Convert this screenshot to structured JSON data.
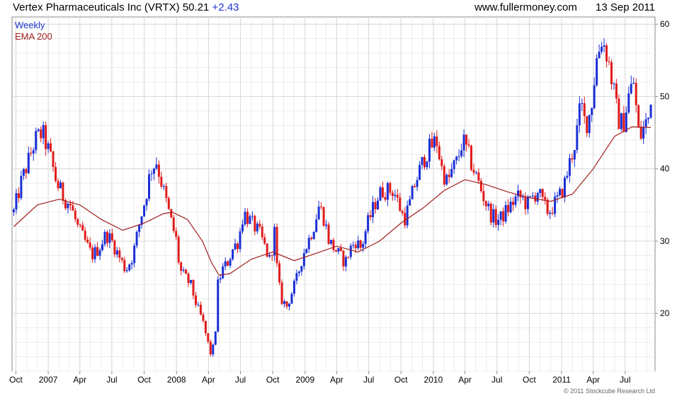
{
  "header": {
    "title": "Vertex Pharmaceuticals Inc (VRTX)",
    "price": "50.21",
    "change": "+2.43",
    "source": "www.fullermoney.com",
    "date": "13 Sep 2011"
  },
  "footer": {
    "copyright": "© 2011 Stockcube Research Ltd"
  },
  "colors": {
    "up": "#1a2fd6",
    "down": "#e01b1b",
    "ema": "#a11d1d",
    "grid": "#d9d9d9",
    "border": "#888888",
    "legend_weekly": "#1a33cc",
    "legend_ema": "#a11d1d"
  },
  "chart_data": {
    "type": "line",
    "title": "",
    "xlabel": "",
    "ylabel": "",
    "ylim": [
      12,
      61
    ],
    "yticks": [
      20,
      30,
      40,
      50,
      60
    ],
    "y_axis_position": "right",
    "grid": true,
    "legend_placement": "top-left",
    "x_ticks": [
      "Oct",
      "2007",
      "Apr",
      "Jul",
      "Oct",
      "2008",
      "Apr",
      "Jul",
      "Oct",
      "2009",
      "Apr",
      "Jul",
      "Oct",
      "2010",
      "Apr",
      "Jul",
      "Oct",
      "2011",
      "Apr",
      "Jul"
    ],
    "x_tick_dates": [
      "2006-10-01",
      "2007-01-01",
      "2007-04-01",
      "2007-07-01",
      "2007-10-01",
      "2008-01-01",
      "2008-04-01",
      "2008-07-01",
      "2008-10-01",
      "2009-01-01",
      "2009-04-01",
      "2009-07-01",
      "2009-10-01",
      "2010-01-01",
      "2010-04-01",
      "2010-07-01",
      "2010-10-01",
      "2011-01-01",
      "2011-04-01",
      "2011-07-01"
    ],
    "x_range": [
      "2006-09-20",
      "2011-09-24"
    ],
    "series": [
      {
        "name": "Weekly",
        "style": "candlestick",
        "close_points": [
          [
            "2006-09-25",
            34
          ],
          [
            "2006-10-15",
            38
          ],
          [
            "2006-11-05",
            41
          ],
          [
            "2006-11-25",
            44
          ],
          [
            "2006-12-15",
            45
          ],
          [
            "2007-01-05",
            42
          ],
          [
            "2007-01-25",
            38
          ],
          [
            "2007-02-15",
            36
          ],
          [
            "2007-03-05",
            35
          ],
          [
            "2007-03-25",
            32
          ],
          [
            "2007-04-15",
            30
          ],
          [
            "2007-05-05",
            28
          ],
          [
            "2007-05-25",
            29
          ],
          [
            "2007-06-15",
            31
          ],
          [
            "2007-07-01",
            30
          ],
          [
            "2007-07-20",
            28
          ],
          [
            "2007-08-10",
            26
          ],
          [
            "2007-08-30",
            28
          ],
          [
            "2007-09-20",
            33
          ],
          [
            "2007-10-05",
            36
          ],
          [
            "2007-10-20",
            40
          ],
          [
            "2007-11-05",
            41
          ],
          [
            "2007-11-25",
            37
          ],
          [
            "2007-12-15",
            33
          ],
          [
            "2008-01-01",
            30
          ],
          [
            "2008-01-10",
            26
          ],
          [
            "2008-01-25",
            25
          ],
          [
            "2008-02-10",
            24
          ],
          [
            "2008-02-28",
            21
          ],
          [
            "2008-03-15",
            19
          ],
          [
            "2008-03-30",
            16
          ],
          [
            "2008-04-10",
            14
          ],
          [
            "2008-04-20",
            17
          ],
          [
            "2008-04-28",
            24
          ],
          [
            "2008-05-10",
            26
          ],
          [
            "2008-05-25",
            27
          ],
          [
            "2008-06-10",
            29
          ],
          [
            "2008-06-25",
            30
          ],
          [
            "2008-07-10",
            34
          ],
          [
            "2008-07-25",
            33
          ],
          [
            "2008-08-10",
            32
          ],
          [
            "2008-08-25",
            31
          ],
          [
            "2008-09-10",
            29
          ],
          [
            "2008-09-25",
            27
          ],
          [
            "2008-10-05",
            32
          ],
          [
            "2008-10-15",
            25
          ],
          [
            "2008-10-25",
            22
          ],
          [
            "2008-11-10",
            21
          ],
          [
            "2008-11-25",
            23
          ],
          [
            "2008-12-10",
            25
          ],
          [
            "2008-12-25",
            28
          ],
          [
            "2009-01-10",
            30
          ],
          [
            "2009-01-25",
            32
          ],
          [
            "2009-02-10",
            35
          ],
          [
            "2009-02-25",
            33
          ],
          [
            "2009-03-10",
            30
          ],
          [
            "2009-03-25",
            29
          ],
          [
            "2009-04-10",
            28
          ],
          [
            "2009-04-25",
            27
          ],
          [
            "2009-05-10",
            29
          ],
          [
            "2009-05-25",
            30
          ],
          [
            "2009-06-10",
            29
          ],
          [
            "2009-06-25",
            32
          ],
          [
            "2009-07-10",
            34
          ],
          [
            "2009-07-25",
            36
          ],
          [
            "2009-08-10",
            37
          ],
          [
            "2009-08-25",
            37
          ],
          [
            "2009-09-10",
            37
          ],
          [
            "2009-09-25",
            35
          ],
          [
            "2009-10-10",
            33
          ],
          [
            "2009-10-25",
            35
          ],
          [
            "2009-11-10",
            38
          ],
          [
            "2009-11-25",
            40
          ],
          [
            "2009-12-10",
            42
          ],
          [
            "2009-12-25",
            43
          ],
          [
            "2010-01-10",
            44
          ],
          [
            "2010-01-25",
            40
          ],
          [
            "2010-02-10",
            38
          ],
          [
            "2010-02-25",
            40
          ],
          [
            "2010-03-10",
            41
          ],
          [
            "2010-03-25",
            44
          ],
          [
            "2010-04-10",
            42
          ],
          [
            "2010-04-25",
            40
          ],
          [
            "2010-05-10",
            38
          ],
          [
            "2010-05-25",
            36
          ],
          [
            "2010-06-10",
            34
          ],
          [
            "2010-06-25",
            33
          ],
          [
            "2010-07-10",
            33
          ],
          [
            "2010-07-25",
            34
          ],
          [
            "2010-08-10",
            35
          ],
          [
            "2010-08-25",
            36
          ],
          [
            "2010-09-10",
            36
          ],
          [
            "2010-09-25",
            35
          ],
          [
            "2010-10-10",
            36
          ],
          [
            "2010-10-25",
            37
          ],
          [
            "2010-11-10",
            35
          ],
          [
            "2010-11-25",
            34
          ],
          [
            "2010-12-10",
            35
          ],
          [
            "2010-12-25",
            36
          ],
          [
            "2011-01-10",
            38
          ],
          [
            "2011-01-25",
            41
          ],
          [
            "2011-02-10",
            44
          ],
          [
            "2011-02-25",
            49
          ],
          [
            "2011-03-10",
            46
          ],
          [
            "2011-03-25",
            48
          ],
          [
            "2011-04-10",
            55
          ],
          [
            "2011-04-25",
            58
          ],
          [
            "2011-05-10",
            56
          ],
          [
            "2011-05-25",
            52
          ],
          [
            "2011-06-10",
            47
          ],
          [
            "2011-06-25",
            46
          ],
          [
            "2011-07-10",
            50
          ],
          [
            "2011-07-25",
            52
          ],
          [
            "2011-08-10",
            44
          ],
          [
            "2011-08-25",
            46
          ],
          [
            "2011-09-05",
            47
          ],
          [
            "2011-09-12",
            50.21
          ]
        ]
      },
      {
        "name": "EMA 200",
        "style": "line",
        "points": [
          [
            "2006-09-25",
            32
          ],
          [
            "2006-12-01",
            35
          ],
          [
            "2007-02-01",
            35.8
          ],
          [
            "2007-04-01",
            35
          ],
          [
            "2007-06-01",
            33
          ],
          [
            "2007-08-01",
            31.5
          ],
          [
            "2007-10-01",
            32.5
          ],
          [
            "2007-11-25",
            33.8
          ],
          [
            "2007-12-20",
            34
          ],
          [
            "2008-02-01",
            33
          ],
          [
            "2008-03-15",
            30
          ],
          [
            "2008-04-10",
            27
          ],
          [
            "2008-05-01",
            25.3
          ],
          [
            "2008-06-01",
            25.5
          ],
          [
            "2008-08-01",
            27.5
          ],
          [
            "2008-10-01",
            28.5
          ],
          [
            "2008-12-01",
            27.3
          ],
          [
            "2009-02-01",
            28.3
          ],
          [
            "2009-04-01",
            29.3
          ],
          [
            "2009-06-01",
            28.5
          ],
          [
            "2009-08-01",
            30
          ],
          [
            "2009-10-01",
            32.5
          ],
          [
            "2009-12-01",
            34.5
          ],
          [
            "2010-02-01",
            37
          ],
          [
            "2010-04-01",
            38.5
          ],
          [
            "2010-06-01",
            37.8
          ],
          [
            "2010-08-01",
            36.8
          ],
          [
            "2010-10-01",
            36
          ],
          [
            "2010-12-01",
            35.5
          ],
          [
            "2011-02-01",
            36.5
          ],
          [
            "2011-04-01",
            40
          ],
          [
            "2011-06-01",
            44.5
          ],
          [
            "2011-07-20",
            45.8
          ],
          [
            "2011-09-12",
            45.7
          ]
        ]
      }
    ]
  }
}
